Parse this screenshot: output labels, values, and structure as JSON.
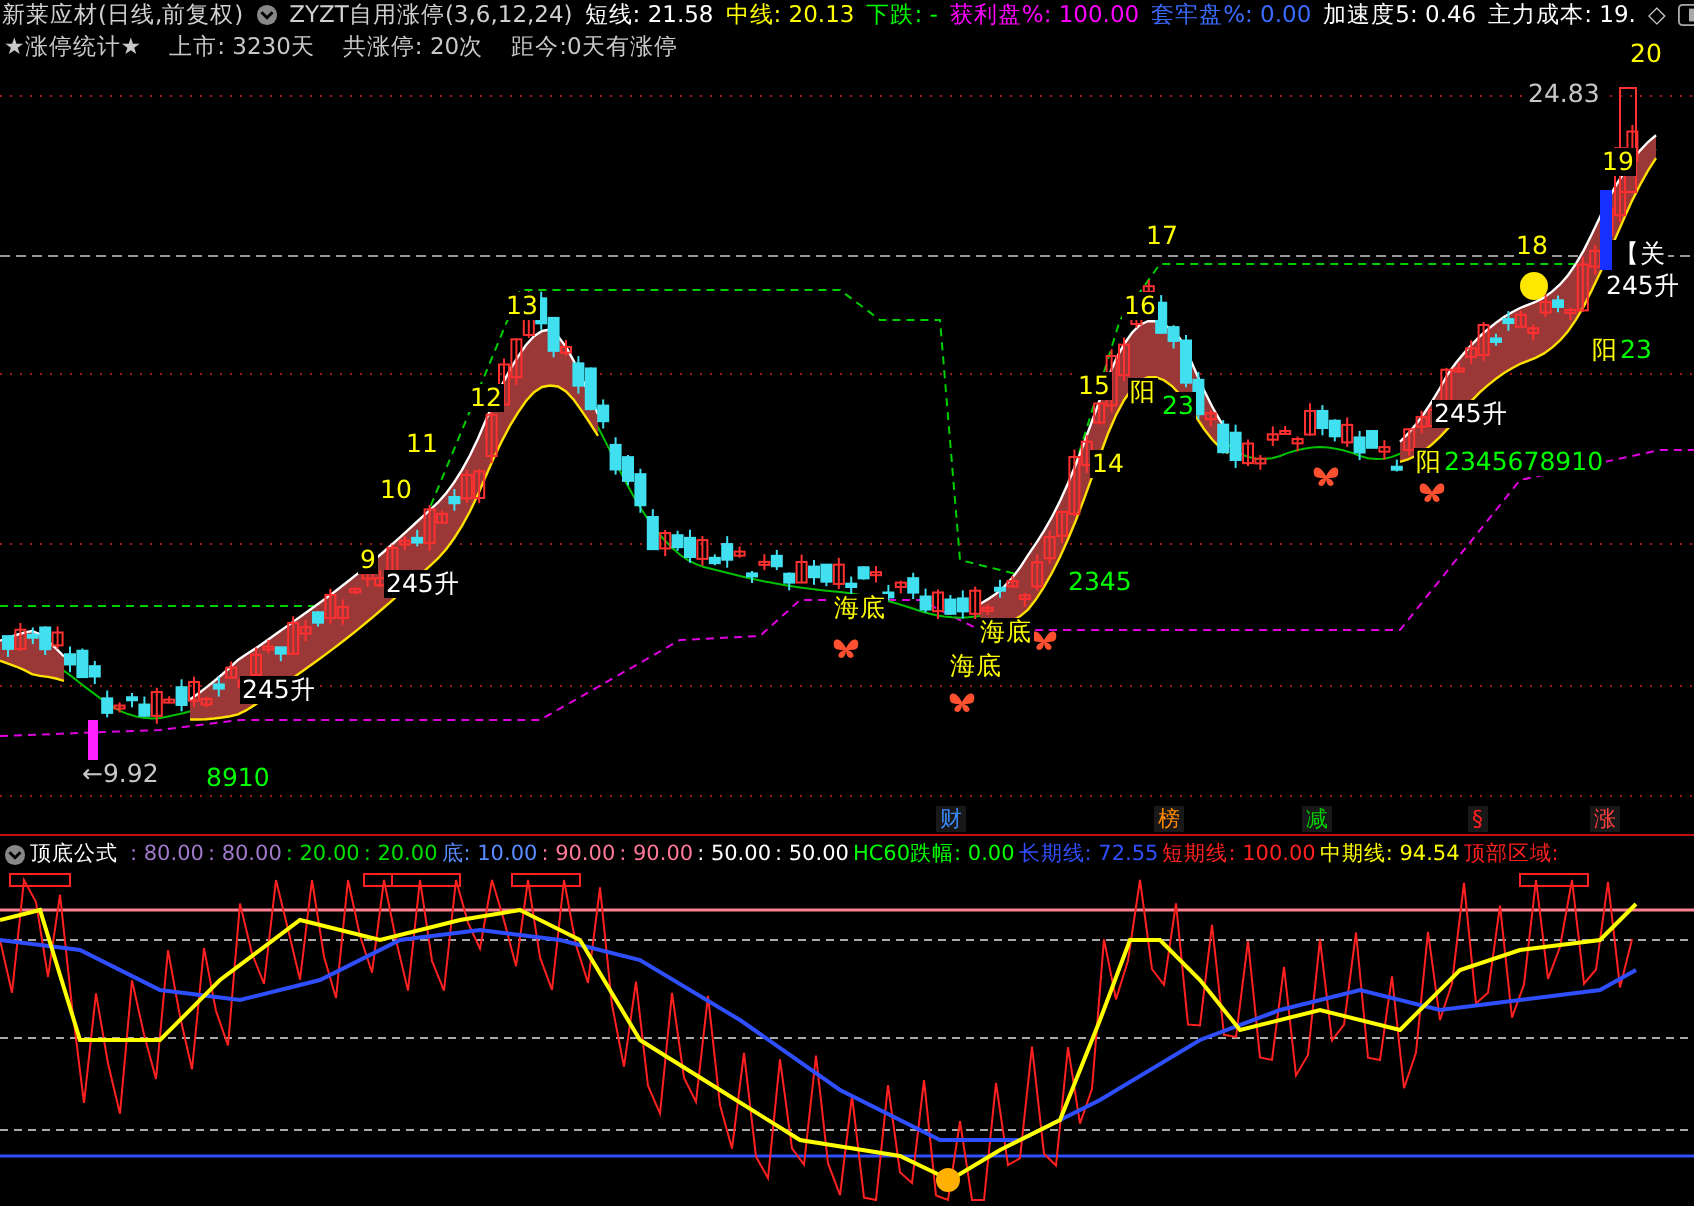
{
  "header": {
    "title": "新莱应材(日线,前复权)",
    "formula": "ZYZT自用涨停(3,6,12,24)",
    "stats": [
      {
        "text": "短线: 21.58",
        "color": "#ffffff"
      },
      {
        "text": "中线: 20.13",
        "color": "#ffff00"
      },
      {
        "text": "下跌: -",
        "color": "#00ff00"
      },
      {
        "text": "获利盘%: 100.00",
        "color": "#ff00ff"
      },
      {
        "text": "套牢盘%: 0.00",
        "color": "#3a6bff"
      },
      {
        "text": "加速度5: 0.46",
        "color": "#ffffff"
      },
      {
        "text": "主力成本: 19.",
        "color": "#ffffff"
      }
    ],
    "end_mark": "◇"
  },
  "summary": [
    "★涨停统计★",
    "上市: 3230天",
    "共涨停: 20次",
    "距今:0天有涨停"
  ],
  "chart_labels": [
    {
      "text": "20",
      "color": "#ffff00"
    },
    {
      "text": "24.83",
      "color": "#c8c8c8"
    },
    {
      "text": "19",
      "color": "#ffff00"
    },
    {
      "text": "18",
      "color": "#ffff00"
    },
    {
      "text": "【关",
      "color": "#ffffff"
    },
    {
      "text": "245升",
      "color": "#ffffff"
    },
    {
      "text": "阳",
      "color": "#ffff00"
    },
    {
      "text": "23",
      "color": "#00ff00"
    },
    {
      "text": "17",
      "color": "#ffff00"
    },
    {
      "text": "16",
      "color": "#ffff00"
    },
    {
      "text": "15",
      "color": "#ffff00"
    },
    {
      "text": "阳",
      "color": "#ffff00"
    },
    {
      "text": "23",
      "color": "#00ff00"
    },
    {
      "text": "14",
      "color": "#ffff00"
    },
    {
      "text": "245升",
      "color": "#ffffff"
    },
    {
      "text": "阳",
      "color": "#ffff00"
    },
    {
      "text": "2345678910",
      "color": "#00ff00"
    },
    {
      "text": "13",
      "color": "#ffff00"
    },
    {
      "text": "12",
      "color": "#ffff00"
    },
    {
      "text": "11",
      "color": "#ffff00"
    },
    {
      "text": "10",
      "color": "#ffff00"
    },
    {
      "text": "9",
      "color": "#ffff00"
    },
    {
      "text": "245升",
      "color": "#ffffff"
    },
    {
      "text": "245升",
      "color": "#ffffff"
    },
    {
      "text": "←9.92",
      "color": "#c8c8c8"
    },
    {
      "text": "8910",
      "color": "#00ff00"
    },
    {
      "text": "海底",
      "color": "#ffff00"
    },
    {
      "text": "海底",
      "color": "#ffff00"
    },
    {
      "text": "海底",
      "color": "#ffff00"
    },
    {
      "text": "2345",
      "color": "#00ff00"
    }
  ],
  "markers": [
    {
      "text": "财",
      "color": "#3a8bff"
    },
    {
      "text": "榜",
      "color": "#ff8a00"
    },
    {
      "text": "减",
      "color": "#00d000"
    },
    {
      "text": "§",
      "color": "#ff2020"
    },
    {
      "text": "涨",
      "color": "#ff4040"
    }
  ],
  "indicator": {
    "name": "顶底公式",
    "values": [
      {
        "text": ": 80.00",
        "color": "#a078c8"
      },
      {
        "text": ": 80.00",
        "color": "#a078c8"
      },
      {
        "text": ": 20.00",
        "color": "#00e000"
      },
      {
        "text": ": 20.00",
        "color": "#00e000"
      },
      {
        "text": "底: 10.00",
        "color": "#5a8cff"
      },
      {
        "text": ": 90.00",
        "color": "#ff7898"
      },
      {
        "text": ": 90.00",
        "color": "#ff7898"
      },
      {
        "text": ": 50.00",
        "color": "#ffffff"
      },
      {
        "text": ": 50.00",
        "color": "#ffffff"
      },
      {
        "text": "HC60跌幅: 0.00",
        "color": "#00ff00"
      },
      {
        "text": "长期线: 72.55",
        "color": "#2f4fff"
      },
      {
        "text": "短期线: 100.00",
        "color": "#ff2020"
      },
      {
        "text": "中期线: 94.54",
        "color": "#ffff00"
      },
      {
        "text": "顶部区域:",
        "color": "#ff2020"
      }
    ]
  }
}
